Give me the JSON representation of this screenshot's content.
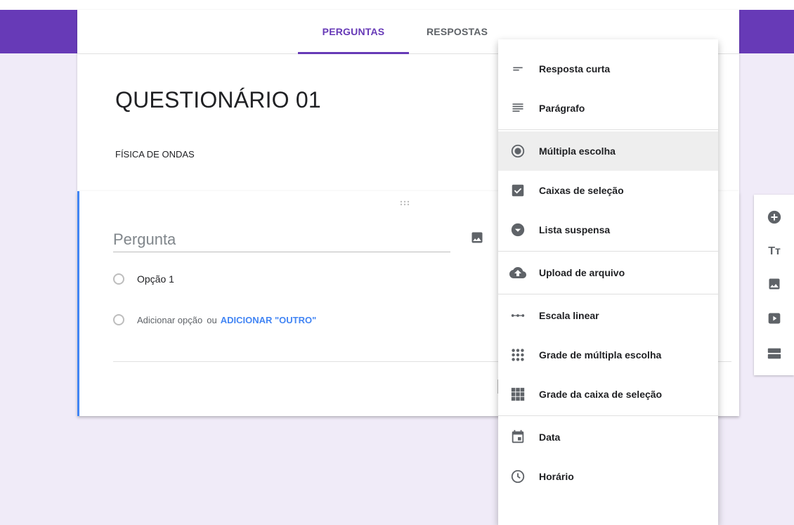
{
  "tabs": [
    {
      "label": "PERGUNTAS",
      "active": true
    },
    {
      "label": "RESPOSTAS",
      "active": false
    }
  ],
  "form": {
    "title": "QUESTIONÁRIO 01",
    "description": "FÍSICA DE ONDAS"
  },
  "question": {
    "placeholder": "Pergunta",
    "option1": "Opção 1",
    "add_option": "Adicionar opção",
    "or": "ou",
    "add_other": "ADICIONAR \"OUTRO\""
  },
  "menu": {
    "items": [
      {
        "label": "Resposta curta",
        "icon": "short-answer-icon"
      },
      {
        "label": "Parágrafo",
        "icon": "paragraph-icon"
      },
      {
        "label": "Múltipla escolha",
        "icon": "radio-button-icon",
        "selected": true
      },
      {
        "label": "Caixas de seleção",
        "icon": "checkbox-icon"
      },
      {
        "label": "Lista suspensa",
        "icon": "dropdown-icon"
      },
      {
        "label": "Upload de arquivo",
        "icon": "cloud-upload-icon"
      },
      {
        "label": "Escala linear",
        "icon": "linear-scale-icon"
      },
      {
        "label": "Grade de múltipla escolha",
        "icon": "grid-dots-icon"
      },
      {
        "label": "Grade da caixa de seleção",
        "icon": "grid-squares-icon"
      },
      {
        "label": "Data",
        "icon": "calendar-icon"
      },
      {
        "label": "Horário",
        "icon": "clock-icon"
      }
    ]
  },
  "side_toolbar": {
    "title_icon_text": "Tт"
  },
  "colors": {
    "primary": "#673ab7",
    "accent": "#4285f4",
    "icon": "#5f6368",
    "background": "#f0ebf8"
  }
}
